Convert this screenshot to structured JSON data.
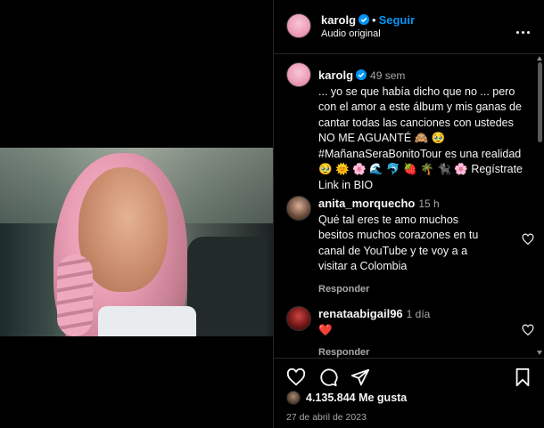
{
  "post": {
    "author": "karolg",
    "follow_label": "Seguir",
    "audio": "Audio original",
    "caption_time": "49 sem",
    "caption_text": "... yo se que había dicho que no ... pero con el amor a este álbum y mis ganas de cantar todas las canciones con ustedes NO ME AGUANTÉ 🙈 🥹 #MañanaSeraBonitoTour es una realidad 🥹 🌞 🌸 🌊 🐬 🍓 🌴 🐈‍⬛ 🌸 Regístrate Link in BIO"
  },
  "comments": [
    {
      "user": "anita_morquecho",
      "time": "15 h",
      "text": "Qué tal eres te amo muchos besitos muchos corazones en tu canal de YouTube y te voy a a visitar a Colombia",
      "reply_label": "Responder"
    },
    {
      "user": "renataabigail96",
      "time": "1 día",
      "text": "❤️",
      "reply_label": "Responder"
    }
  ],
  "footer": {
    "likes": "4.135.844 Me gusta",
    "date": "27 de abril de 2023"
  },
  "icons": [
    "verified-icon",
    "more-icon",
    "heart-icon",
    "comment-icon",
    "share-icon",
    "save-icon"
  ],
  "colors": {
    "accent": "#0095f6",
    "background": "#000000",
    "muted": "#a8a8a8"
  }
}
